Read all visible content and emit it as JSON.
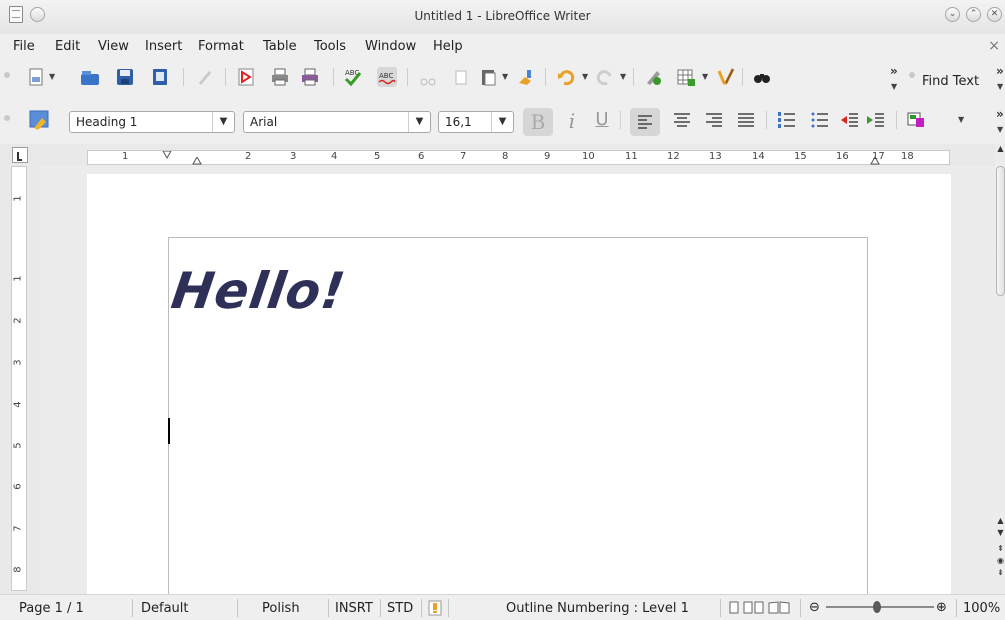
{
  "window": {
    "title": "Untitled 1 - LibreOffice Writer"
  },
  "menubar": {
    "items": [
      "File",
      "Edit",
      "View",
      "Insert",
      "Format",
      "Table",
      "Tools",
      "Window",
      "Help"
    ],
    "close_symbol": "×"
  },
  "standard_toolbar": {
    "icons": [
      "new-document-icon",
      "open-file-icon",
      "save-icon",
      "export-icon",
      "edit-mode-icon",
      "export-pdf-icon",
      "print-icon",
      "print-preview-icon",
      "spellcheck-icon",
      "autospellcheck-icon",
      "cut-icon",
      "copy-icon",
      "paste-icon",
      "clone-formatting-icon",
      "undo-icon",
      "redo-icon",
      "insert-chart-icon",
      "insert-table-icon",
      "draw-functions-icon",
      "find-binoculars-icon"
    ],
    "overflow_symbol": "»",
    "find_label": "Find Text"
  },
  "formatting_toolbar": {
    "paragraph_style": "Heading 1",
    "font_name": "Arial",
    "font_size": "16,1",
    "bold_glyph": "B",
    "italic_glyph": "i",
    "underline_glyph": "U"
  },
  "ruler": {
    "horizontal_ticks": [
      "1",
      "2",
      "3",
      "4",
      "5",
      "6",
      "7",
      "8",
      "9",
      "10",
      "11",
      "12",
      "13",
      "14",
      "15",
      "16",
      "17",
      "18"
    ],
    "vertical_ticks": [
      "1",
      "1",
      "2",
      "3",
      "4",
      "5",
      "6",
      "7",
      "8"
    ]
  },
  "document": {
    "text": "Hello!"
  },
  "statusbar": {
    "page": "Page 1 / 1",
    "page_style": "Default",
    "language": "Polish",
    "insert_mode": "INSRT",
    "selection_mode": "STD",
    "outline": "Outline Numbering : Level 1",
    "zoom_minus": "⊖",
    "zoom_plus": "⊕",
    "zoom": "100%",
    "zoom_level": 1.0
  },
  "colors": {
    "accent_blue": "#3a74c8",
    "hello_text": "#2e3057",
    "document_background": "#6b6b6b"
  }
}
